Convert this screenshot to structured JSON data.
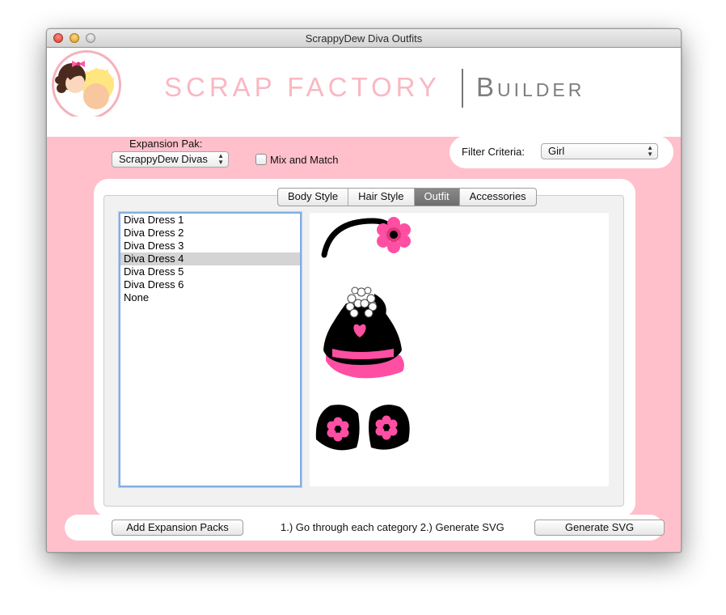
{
  "window": {
    "title": "ScrappyDew Diva Outfits"
  },
  "header": {
    "brand_left": "SCRAP FACTORY",
    "brand_right": "Builder"
  },
  "controls": {
    "expansion_label": "Expansion Pak:",
    "expansion_value": "ScrappyDew Divas",
    "mix_label": "Mix and Match",
    "mix_checked": false,
    "filter_label": "Filter Criteria:",
    "filter_value": "Girl"
  },
  "tabs": [
    {
      "label": "Body Style",
      "selected": false
    },
    {
      "label": "Hair Style",
      "selected": false
    },
    {
      "label": "Outfit",
      "selected": true
    },
    {
      "label": "Accessories",
      "selected": false
    }
  ],
  "outfits": {
    "items": [
      "Diva Dress 1",
      "Diva Dress 2",
      "Diva Dress 3",
      "Diva Dress 4",
      "Diva Dress 5",
      "Diva Dress 6",
      "None"
    ],
    "selected_index": 3
  },
  "footer": {
    "add_button": "Add Expansion Packs",
    "instructions": "1.) Go through each category 2.)  Generate SVG",
    "generate_button": "Generate SVG"
  },
  "colors": {
    "background_pink": "#ffc0cb",
    "brand_pink": "#f9b8c3",
    "accent_hotpink": "#ff4fa3",
    "selection_gray": "#d4d4d4"
  }
}
